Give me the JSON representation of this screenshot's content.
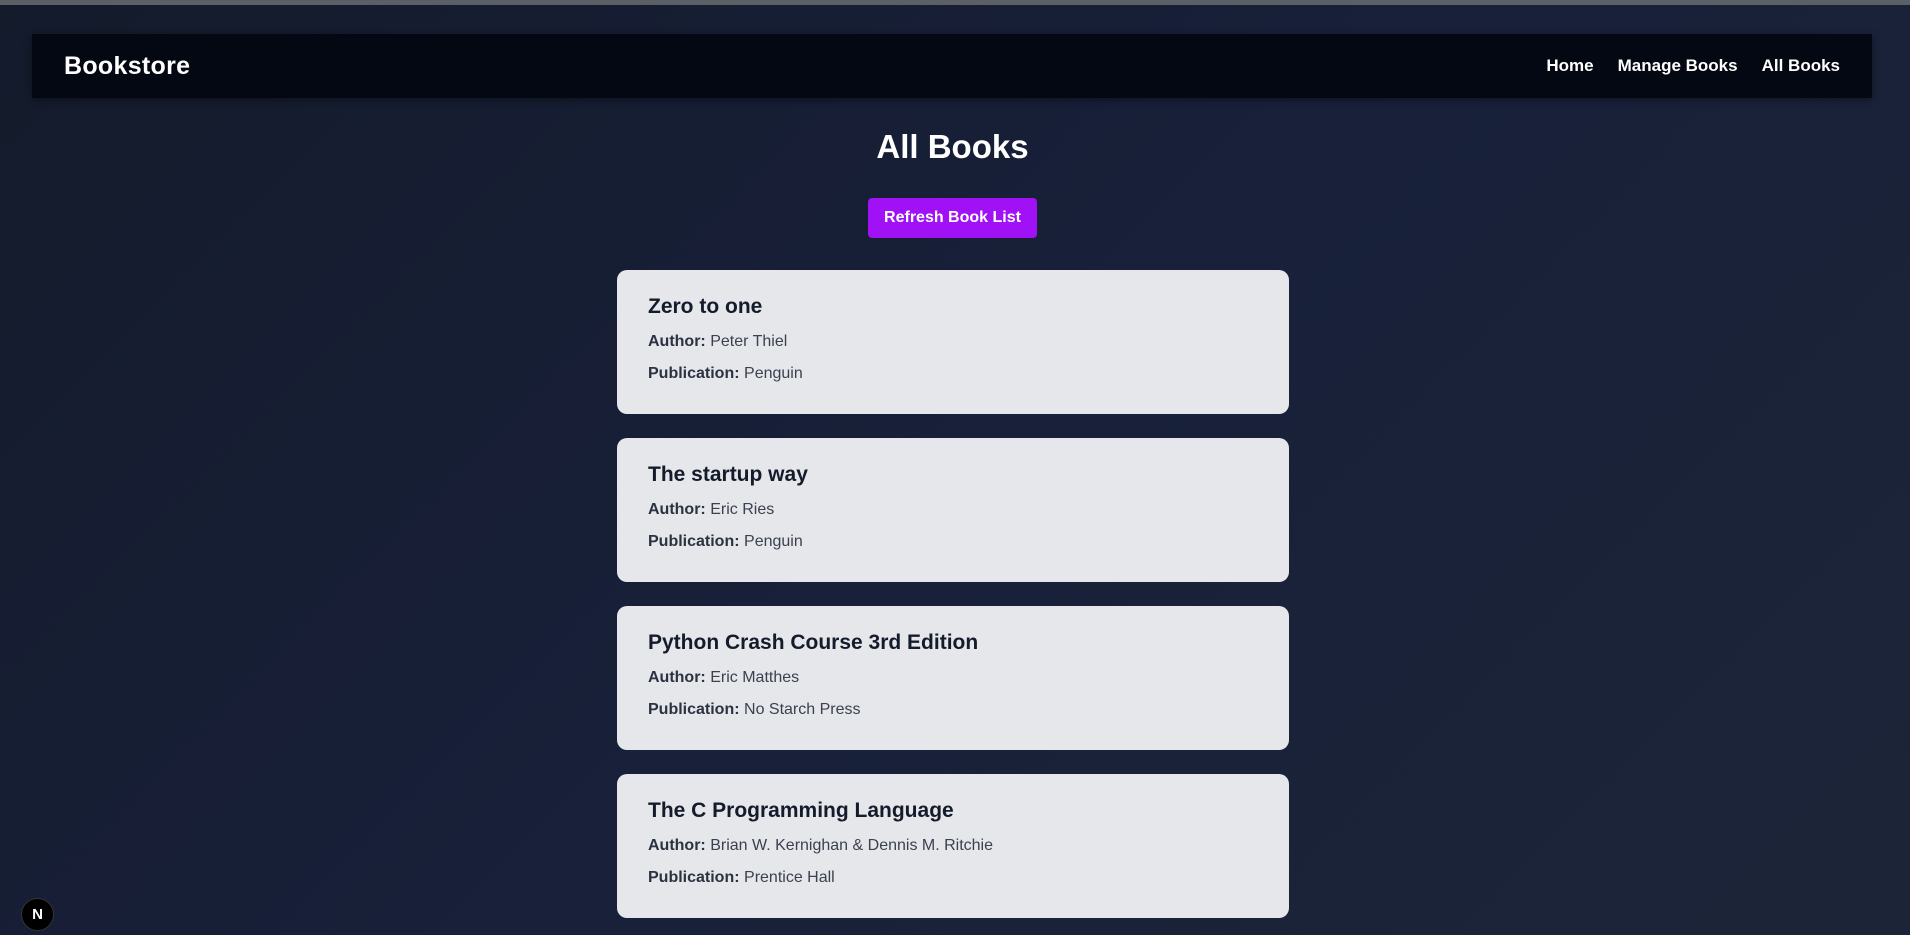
{
  "navbar": {
    "brand": "Bookstore",
    "links": [
      "Home",
      "Manage Books",
      "All Books"
    ]
  },
  "main": {
    "title": "All Books",
    "refresh_label": "Refresh Book List"
  },
  "labels": {
    "author": "Author:",
    "publication": "Publication:"
  },
  "books": [
    {
      "title": "Zero to one",
      "author": "Peter Thiel",
      "publication": "Penguin"
    },
    {
      "title": "The startup way",
      "author": "Eric Ries",
      "publication": "Penguin"
    },
    {
      "title": "Python Crash Course 3rd Edition",
      "author": "Eric Matthes",
      "publication": "No Starch Press"
    },
    {
      "title": "The C Programming Language",
      "author": "Brian W. Kernighan & Dennis M. Ritchie",
      "publication": "Prentice Hall"
    }
  ],
  "badge": {
    "letter": "N"
  },
  "colors": {
    "accent": "#a012f5",
    "navbar": "#040812",
    "card": "#e6e7ea"
  }
}
